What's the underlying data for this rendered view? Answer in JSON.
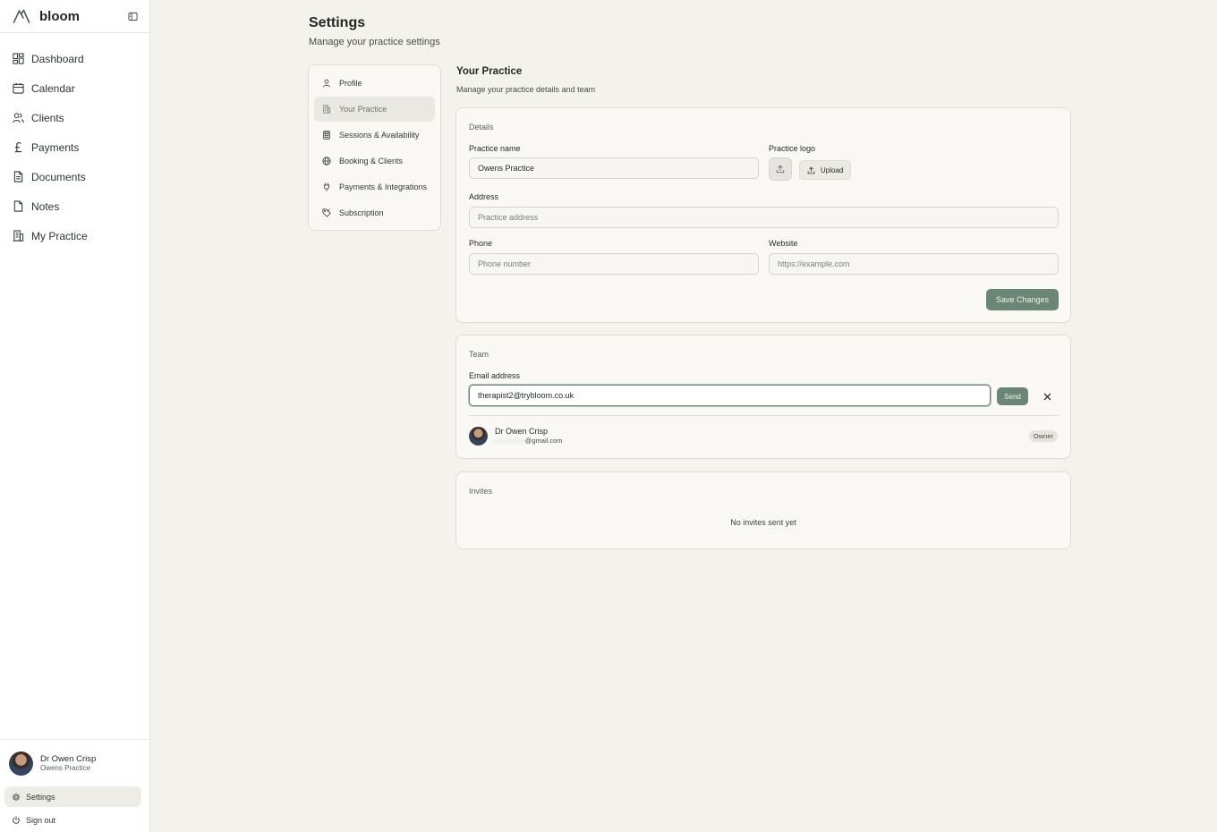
{
  "app": {
    "name": "bloom"
  },
  "sidebar": {
    "items": [
      {
        "label": "Dashboard",
        "icon": "dashboard-icon"
      },
      {
        "label": "Calendar",
        "icon": "calendar-icon"
      },
      {
        "label": "Clients",
        "icon": "users-icon"
      },
      {
        "label": "Payments",
        "icon": "pound-icon"
      },
      {
        "label": "Documents",
        "icon": "document-icon"
      },
      {
        "label": "Notes",
        "icon": "note-icon"
      },
      {
        "label": "My Practice",
        "icon": "building-icon"
      }
    ],
    "user": {
      "name": "Dr Owen Crisp",
      "practice": "Owens Practice"
    },
    "settings_label": "Settings",
    "signout_label": "Sign out"
  },
  "page": {
    "title": "Settings",
    "subtitle": "Manage your practice settings"
  },
  "settings_nav": {
    "items": [
      {
        "label": "Profile",
        "icon": "user-icon"
      },
      {
        "label": "Your Practice",
        "icon": "building-icon",
        "active": true
      },
      {
        "label": "Sessions & Availability",
        "icon": "calculator-icon"
      },
      {
        "label": "Booking & Clients",
        "icon": "globe-icon"
      },
      {
        "label": "Payments & Integrations",
        "icon": "plug-icon"
      },
      {
        "label": "Subscription",
        "icon": "tag-icon"
      }
    ]
  },
  "section": {
    "title": "Your Practice",
    "subtitle": "Manage your practice details and team"
  },
  "details": {
    "title": "Details",
    "practice_name_label": "Practice name",
    "practice_name_value": "Owens Practice",
    "practice_logo_label": "Practice logo",
    "upload_label": "Upload",
    "address_label": "Address",
    "address_placeholder": "Practice address",
    "phone_label": "Phone",
    "phone_placeholder": "Phone number",
    "website_label": "Website",
    "website_placeholder": "https://example.com",
    "save_label": "Save Changes"
  },
  "team": {
    "title": "Team",
    "email_label": "Email address",
    "email_value": "therapist2@trybloom.co.uk",
    "send_label": "Send",
    "members": [
      {
        "name": "Dr Owen Crisp",
        "email_hidden": "owencrisp",
        "email_domain": "@gmail.com",
        "role": "Owner"
      }
    ]
  },
  "invites": {
    "title": "Invites",
    "empty_message": "No invites sent yet"
  },
  "colors": {
    "accent": "#6a8676",
    "background": "#f4f2ec",
    "surface": "#f9f8f5"
  }
}
